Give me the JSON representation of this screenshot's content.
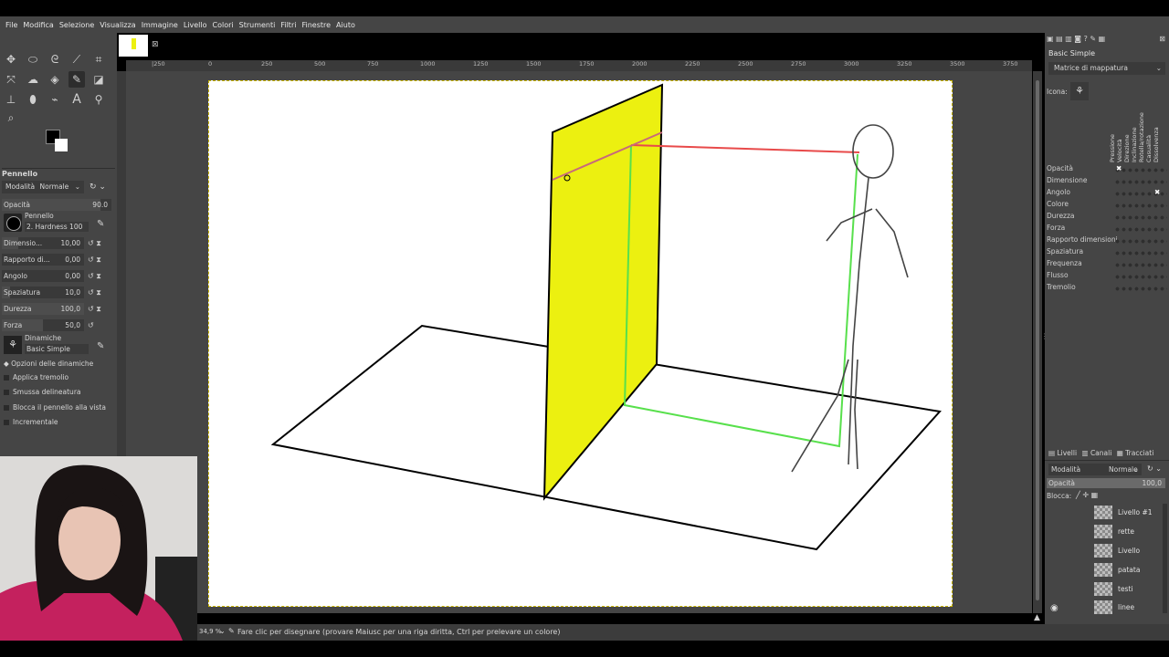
{
  "menu": [
    "File",
    "Modifica",
    "Selezione",
    "Visualizza",
    "Immagine",
    "Livello",
    "Colori",
    "Strumenti",
    "Filtri",
    "Finestre",
    "Aiuto"
  ],
  "tool_options": {
    "title": "Pennello",
    "mode_label": "Modalità",
    "mode_value": "Normale",
    "opacity_label": "Opacità",
    "opacity_value": "90.0",
    "brush_label": "Pennello",
    "brush_value": "2. Hardness 100",
    "params": [
      {
        "label": "Dimensio...",
        "value": "10,00"
      },
      {
        "label": "Rapporto di...",
        "value": "0,00"
      },
      {
        "label": "Angolo",
        "value": "0,00"
      },
      {
        "label": "Spaziatura",
        "value": "10,0"
      },
      {
        "label": "Durezza",
        "value": "100,0"
      },
      {
        "label": "Forza",
        "value": "50,0"
      }
    ],
    "dynamics_label": "Dinamiche",
    "dynamics_value": "Basic Simple",
    "dyn_options_label": "Opzioni delle dinamiche",
    "checks": [
      "Applica tremolio",
      "Smussa delineatura",
      "Blocca il pennello alla vista",
      "Incrementale"
    ]
  },
  "ruler_labels": [
    "|250",
    "0",
    "250",
    "500",
    "750",
    "1000",
    "1250",
    "1500",
    "1750",
    "2000",
    "2250",
    "2500",
    "2750",
    "3000",
    "3250",
    "3500",
    "3750"
  ],
  "dynamics_panel": {
    "name": "Basic Simple",
    "matrix_label": "Matrice di mappatura",
    "icon_label": "Icona:",
    "columns": [
      "Pressione",
      "Velocità",
      "Direzione",
      "Inclinazione",
      "Rotella/rotazione",
      "Casualità",
      "Dissolvenza"
    ],
    "rows": [
      "Opacità",
      "Dimensione",
      "Angolo",
      "Colore",
      "Durezza",
      "Forza",
      "Rapporto dimensioni",
      "Spaziatura",
      "Frequenza",
      "Flusso",
      "Tremolio"
    ]
  },
  "layers_panel": {
    "tabs": [
      "Livelli",
      "Canali",
      "Tracciati"
    ],
    "mode_label": "Modalità",
    "mode_value": "Normale",
    "opacity_label": "Opacità",
    "opacity_value": "100,0",
    "lock_label": "Blocca:",
    "layers": [
      "Livello #1",
      "rette",
      "Livello",
      "patata",
      "testi",
      "linee"
    ]
  },
  "status": {
    "zoom": "34,9 %",
    "message": "Fare clic per disegnare (provare Maiusc per una riga diritta, Ctrl per prelevare un colore)"
  },
  "colors": {
    "accent_yellow": "#ecf010",
    "red_line": "#e84a4a",
    "green_line": "#58e04c"
  }
}
